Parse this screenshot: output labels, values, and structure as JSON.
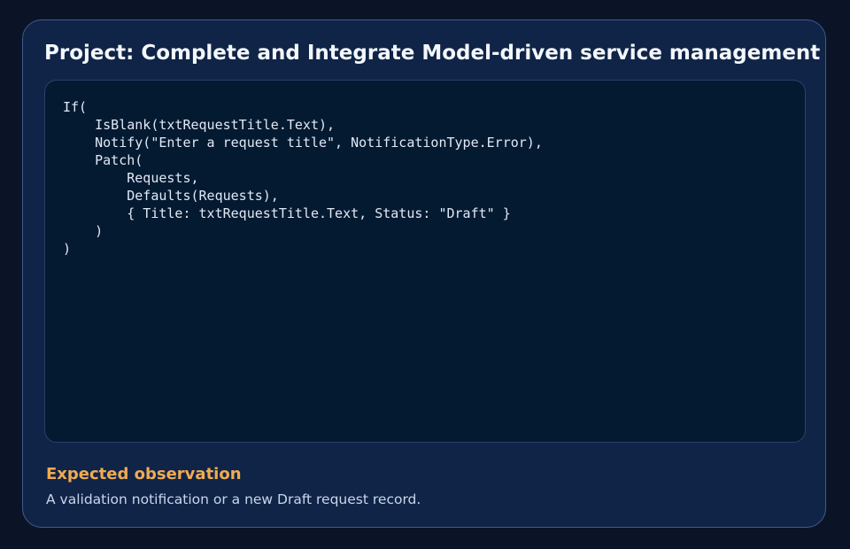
{
  "card": {
    "title": "Project: Complete and Integrate Model-driven service management",
    "code": "If(\n    IsBlank(txtRequestTitle.Text),\n    Notify(\"Enter a request title\", NotificationType.Error),\n    Patch(\n        Requests,\n        Defaults(Requests),\n        { Title: txtRequestTitle.Text, Status: \"Draft\" }\n    )\n)",
    "observation_heading": "Expected observation",
    "observation_text": "A validation notification or a new Draft request record."
  },
  "colors": {
    "page_background": "#0b1426",
    "card_background": "#0f2447",
    "card_border": "#3e5c8c",
    "code_background": "#041a31",
    "title_text": "#f4f7fc",
    "heading_accent": "#f0ab52",
    "body_text": "#c9d6ea"
  }
}
